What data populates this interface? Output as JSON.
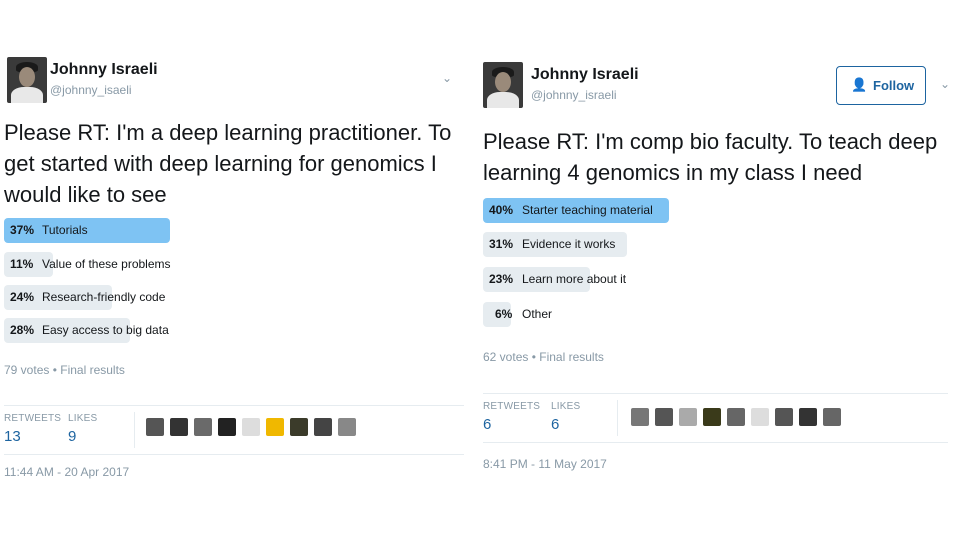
{
  "tweets": [
    {
      "author_name": "Johnny Israeli",
      "author_handle": "@johnny_isaeli",
      "text_lines": [
        "Please RT: I'm a deep learning practitioner. To",
        "get started with deep learning for genomics I",
        "would like to see"
      ],
      "poll": [
        {
          "pct": "37%",
          "label": "Tutorials",
          "fraction": 0.37,
          "winner": true
        },
        {
          "pct": "11%",
          "label": "Value of these problems",
          "fraction": 0.11,
          "winner": false
        },
        {
          "pct": "24%",
          "label": "Research-friendly code",
          "fraction": 0.24,
          "winner": false
        },
        {
          "pct": "28%",
          "label": "Easy access to big data",
          "fraction": 0.28,
          "winner": false
        }
      ],
      "votes": "79 votes • Final results",
      "retweets_label": "RETWEETS",
      "retweets": "13",
      "likes_label": "LIKES",
      "likes": "9",
      "timestamp": "11:44 AM - 20 Apr 2017"
    },
    {
      "author_name": "Johnny Israeli",
      "author_handle": "@johnny_israeli",
      "follow_label": "Follow",
      "text_lines": [
        "Please RT: I'm comp bio faculty. To teach deep",
        "learning 4 genomics in my class I need"
      ],
      "poll": [
        {
          "pct": "40%",
          "label": "Starter teaching material",
          "fraction": 0.4,
          "winner": true
        },
        {
          "pct": "31%",
          "label": "Evidence it works",
          "fraction": 0.31,
          "winner": false
        },
        {
          "pct": "23%",
          "label": "Learn more about it",
          "fraction": 0.23,
          "winner": false
        },
        {
          "pct": "6%",
          "label": "Other",
          "fraction": 0.06,
          "winner": false
        }
      ],
      "votes": "62 votes • Final results",
      "retweets_label": "RETWEETS",
      "retweets": "6",
      "likes_label": "LIKES",
      "likes": "6",
      "timestamp": "8:41 PM - 11 May 2017"
    }
  ],
  "colors": {
    "winner_bar": "#7ec3f3",
    "bar": "#e6ecf0",
    "link": "#1d64a0",
    "muted": "#8899a6"
  },
  "icons": {
    "caret": "chevron-down-icon",
    "follow": "add-user-icon"
  }
}
